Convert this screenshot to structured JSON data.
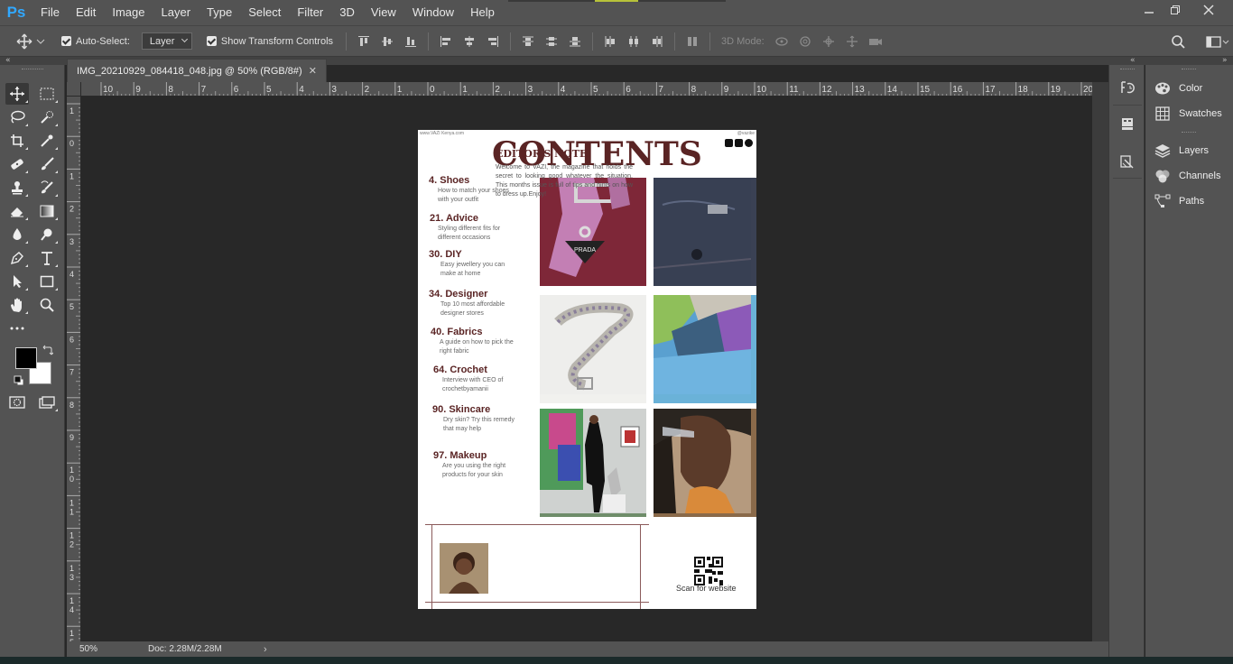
{
  "app": {
    "logo": "Ps",
    "menu": [
      "File",
      "Edit",
      "Image",
      "Layer",
      "Type",
      "Select",
      "Filter",
      "3D",
      "View",
      "Window",
      "Help"
    ]
  },
  "options": {
    "auto_select_label": "Auto-Select:",
    "auto_select_value": "Layer",
    "show_transform_label": "Show Transform Controls",
    "mode_3d_label": "3D Mode:"
  },
  "document": {
    "tab_title": "IMG_20210929_084418_048.jpg @ 50% (RGB/8#)",
    "zoom": "50%",
    "doc_size": "Doc: 2.28M/2.28M"
  },
  "rulers": {
    "top": [
      "10",
      "9",
      "8",
      "7",
      "6",
      "5",
      "4",
      "3",
      "2",
      "1",
      "0",
      "1",
      "2",
      "3",
      "4",
      "5",
      "6",
      "7",
      "8",
      "9",
      "10",
      "11",
      "12",
      "13",
      "14",
      "15",
      "16",
      "17",
      "18",
      "19",
      "20"
    ],
    "left": [
      "1",
      "0",
      "1",
      "2",
      "3",
      "4",
      "5",
      "6",
      "7",
      "8",
      "9",
      "10",
      "11",
      "12",
      "13",
      "14",
      "15"
    ]
  },
  "page": {
    "site": "www.VAZI Kenya.com",
    "handle": "@vazike",
    "title": "CONTENTS",
    "toc": [
      {
        "heading": "4. Shoes",
        "desc": "How to match your shoes with your outfit"
      },
      {
        "heading": "21. Advice",
        "desc": "Styling different fits for different occasions"
      },
      {
        "heading": "30. DIY",
        "desc": "Easy jewellery you can make at home"
      },
      {
        "heading": "34. Designer",
        "desc": "Top 10 most affordable designer stores"
      },
      {
        "heading": "40. Fabrics",
        "desc": "A guide on how to pick the right fabric"
      },
      {
        "heading": "64. Crochet",
        "desc": "Interview with CEO of crochetbyamanii"
      },
      {
        "heading": "90. Skincare",
        "desc": "Dry skin? Try this remedy that may help"
      },
      {
        "heading": "97. Makeup",
        "desc": "Are you using the right products for your skin"
      }
    ],
    "photo_text": "PRADA",
    "editor_title": "EDITOR'S NOTE",
    "editor_body": "Welcome to VAZI, the magazine that holds the secret to looking good whatever the situation. This months issue is full of tips and hints on how to dress up.Enjoy!",
    "qr_label": "Scan for website"
  },
  "panels": [
    "Color",
    "Swatches",
    "Layers",
    "Channels",
    "Paths"
  ],
  "colors": {
    "chrome": "#535353",
    "canvas": "#282828",
    "accent": "#31a8ff",
    "title_brown": "#5a2424"
  }
}
